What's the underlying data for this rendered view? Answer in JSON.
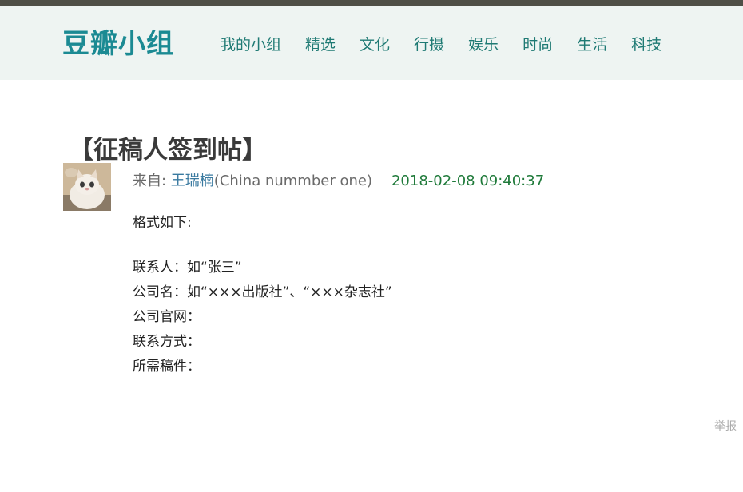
{
  "site": {
    "logo": "豆瓣小组"
  },
  "nav": {
    "items": [
      "我的小组",
      "精选",
      "文化",
      "行摄",
      "娱乐",
      "时尚",
      "生活",
      "科技"
    ]
  },
  "post": {
    "title": "【征稿人签到帖】",
    "from_label": "来自: ",
    "author_name": "王瑞楠",
    "author_suffix": "(China nummber one)",
    "timestamp": "2018-02-08 09:40:37",
    "body_intro": "格式如下:",
    "body_lines": [
      "联系人：如“张三”",
      "公司名：如“×××出版社”、“×××杂志社”",
      "公司官网：",
      "联系方式：",
      "所需稿件："
    ]
  },
  "actions": {
    "report_label": "举报"
  },
  "avatar": {
    "icon": "cat-photo-avatar"
  },
  "colors": {
    "brand": "#1b8a93",
    "nav_text": "#1f7a74",
    "date_green": "#1f7a3a",
    "header_bg": "#eef4f2"
  }
}
